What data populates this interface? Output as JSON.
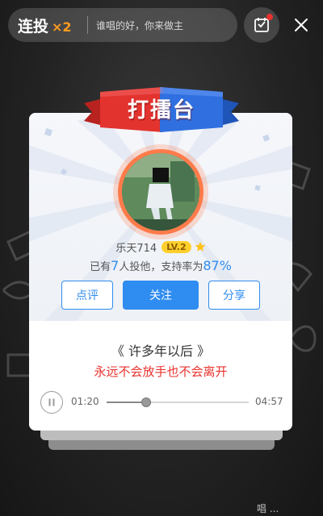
{
  "topbar": {
    "combo_label": "连投",
    "combo_multiplier": "×2",
    "slogan": "谁唱的好，你来做主"
  },
  "banner": {
    "title": "打擂台"
  },
  "singer": {
    "name": "乐天714",
    "level": "LV.2",
    "vote_prefix": "已有",
    "vote_count": "7",
    "vote_middle": "人投他，支持率为",
    "support_rate": "87%"
  },
  "actions": {
    "comment_label": "点评",
    "follow_label": "关注",
    "share_label": "分享"
  },
  "song": {
    "title": "《 许多年以后 》",
    "lyric": "永远不会放手也不会离开"
  },
  "player": {
    "current_time": "01:20",
    "total_time": "04:57",
    "progress": 0.28
  },
  "watermark": "唱 ...",
  "icons": {
    "ticket": "ticket-icon",
    "close": "close-icon",
    "pause": "pause-icon",
    "star": "star-icon"
  },
  "colors": {
    "accent_blue": "#2f8cf0",
    "lyric_red": "#e8322e",
    "combo_orange": "#ff9a1f",
    "level_yellow": "#ffcf2d",
    "banner_red": "#e2332f",
    "banner_blue": "#2f6fe0"
  }
}
